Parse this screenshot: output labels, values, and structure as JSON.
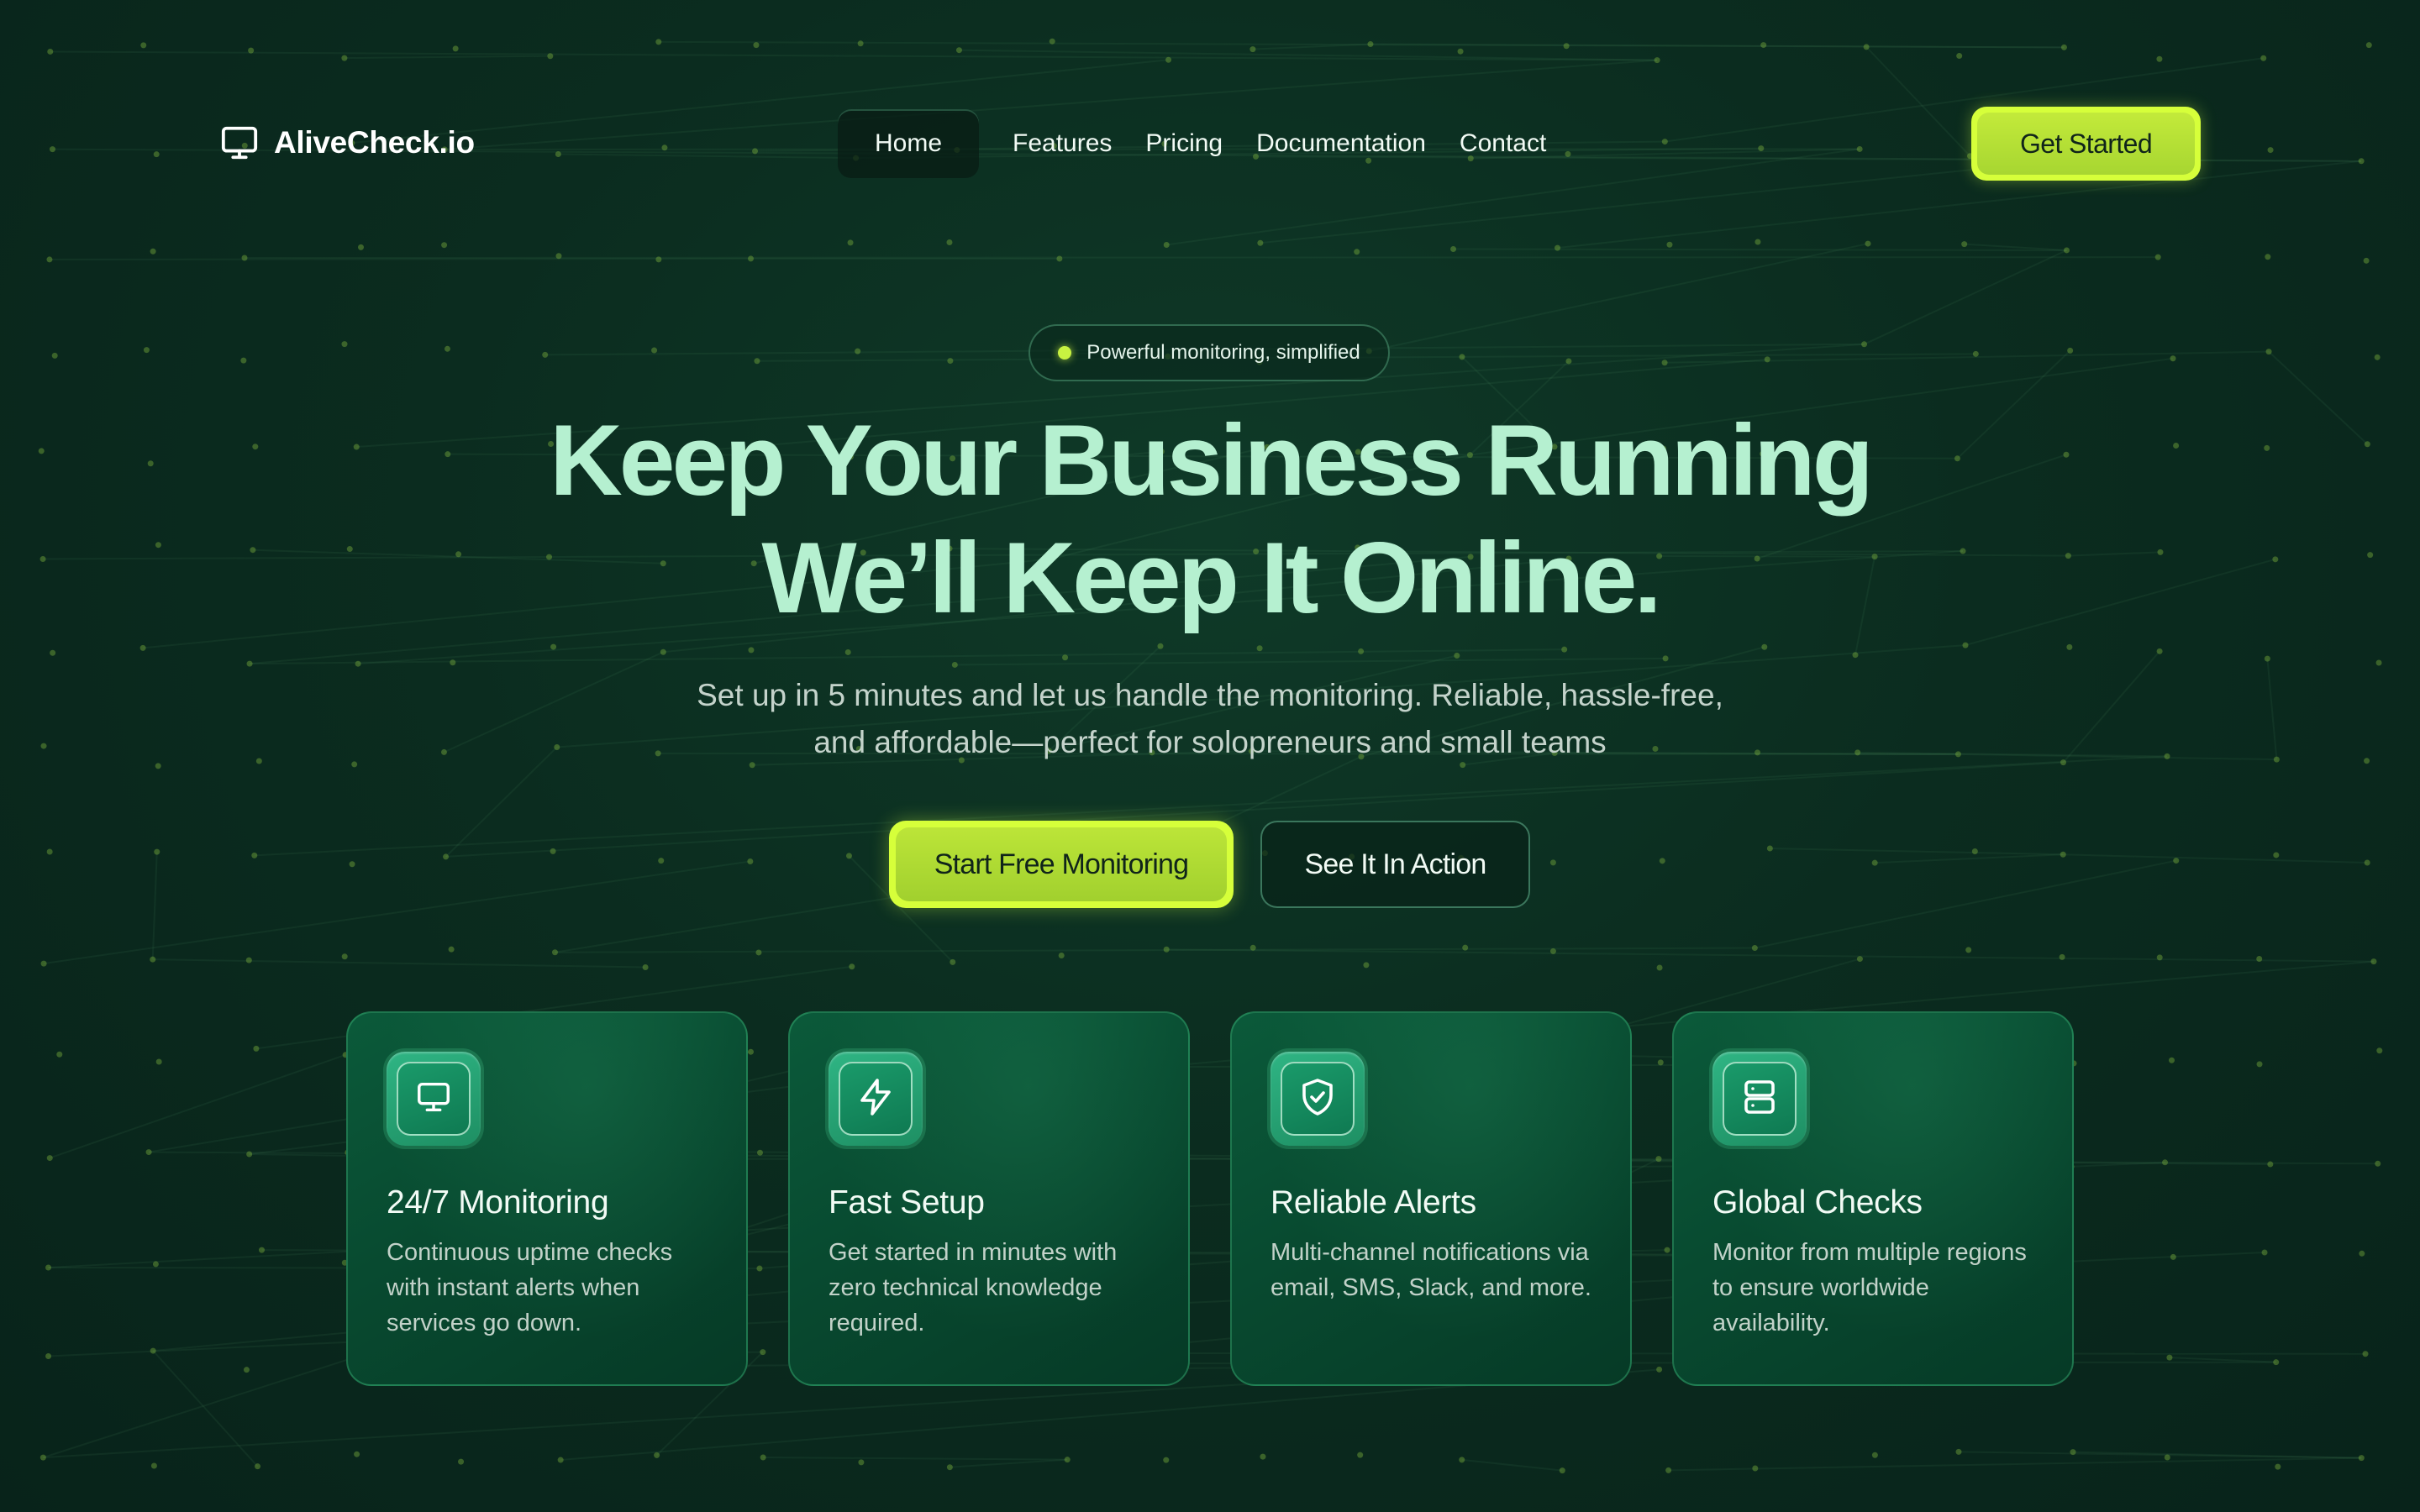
{
  "brand": {
    "name": "AliveCheck.io",
    "icon": "monitor-icon"
  },
  "nav": {
    "items": [
      {
        "label": "Home",
        "active": true
      },
      {
        "label": "Features",
        "active": false
      },
      {
        "label": "Pricing",
        "active": false
      },
      {
        "label": "Documentation",
        "active": false
      },
      {
        "label": "Contact",
        "active": false
      }
    ],
    "cta_label": "Get Started"
  },
  "hero": {
    "badge_text": "Powerful monitoring, simplified",
    "headline_line1": "Keep Your Business Running",
    "headline_line2": "We’ll Keep It Online.",
    "subtitle": "Set up in 5 minutes and let us handle the monitoring. Reliable, hassle-free, and affordable—perfect for solopreneurs and small teams",
    "primary_cta": "Start Free Monitoring",
    "secondary_cta": "See It In Action"
  },
  "features": [
    {
      "icon": "monitor-icon",
      "title": "24/7 Monitoring",
      "description": "Continuous uptime checks with instant alerts when services go down."
    },
    {
      "icon": "lightning-icon",
      "title": "Fast Setup",
      "description": "Get started in minutes with zero technical knowledge required."
    },
    {
      "icon": "shield-check-icon",
      "title": "Reliable Alerts",
      "description": "Multi-channel notifications via email, SMS, Slack, and more."
    },
    {
      "icon": "server-icon",
      "title": "Global Checks",
      "description": "Monitor from multiple regions to ensure worldwide availability."
    }
  ],
  "colors": {
    "background": "#0b2c1f",
    "accent_lime": "#d6ff3a",
    "headline_mint": "#b5f0d0",
    "card_green": "#084a30"
  }
}
